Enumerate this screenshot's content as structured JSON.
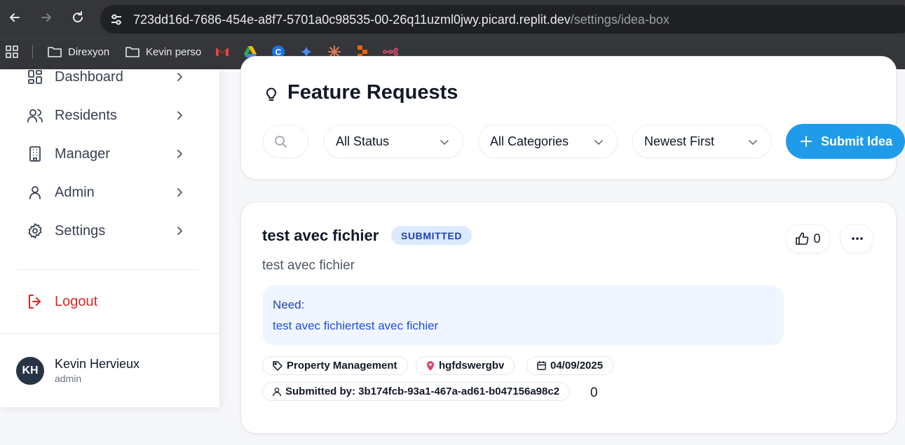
{
  "browser": {
    "url_main": "723dd16d-7686-454e-a8f7-5701a0c98535-00-26q11uzml0jwy.picard.replit.dev",
    "url_path": "/settings/idea-box",
    "bookmarks": [
      {
        "label": "Direxyon",
        "icon": "folder-icon"
      },
      {
        "label": "Kevin perso",
        "icon": "folder-icon"
      }
    ]
  },
  "sidebar": {
    "items": [
      {
        "label": "Dashboard",
        "icon": "dashboard-icon"
      },
      {
        "label": "Residents",
        "icon": "users-icon"
      },
      {
        "label": "Manager",
        "icon": "building-icon"
      },
      {
        "label": "Admin",
        "icon": "user-icon"
      },
      {
        "label": "Settings",
        "icon": "gear-icon"
      }
    ],
    "logout_label": "Logout",
    "user": {
      "initials": "KH",
      "name": "Kevin Hervieux",
      "role": "admin"
    }
  },
  "header": {
    "title": "Feature Requests",
    "filters": {
      "status": "All Status",
      "category": "All Categories",
      "sort": "Newest First"
    },
    "submit_label": "Submit Idea"
  },
  "feature": {
    "title": "test avec fichier",
    "status": "SUBMITTED",
    "description": "test avec fichier",
    "need_label": "Need:",
    "need_text": "test avec fichiertest avec fichier",
    "category": "Property Management",
    "location": "hgfdswergbv",
    "date": "04/09/2025",
    "submitted_by": "Submitted by: 3b174fcb-93a1-467a-ad61-b047156a98c2",
    "extra_count": "0",
    "votes": "0"
  },
  "colors": {
    "accent": "#1e9ce9",
    "logout": "#dc2626",
    "badge_bg": "#dbeafe",
    "badge_text": "#1e40af"
  }
}
